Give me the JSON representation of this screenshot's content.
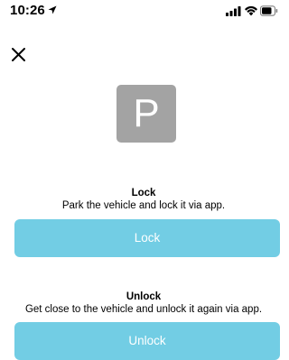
{
  "status_bar": {
    "time": "10:26",
    "icons": [
      "location-arrow-icon",
      "signal-bars-icon",
      "wifi-icon",
      "battery-icon"
    ]
  },
  "header": {
    "close_icon": "close-icon"
  },
  "parking": {
    "symbol": "P"
  },
  "lock": {
    "title": "Lock",
    "description": "Park the vehicle and lock it via app.",
    "button_label": "Lock"
  },
  "unlock": {
    "title": "Unlock",
    "description": "Get close to the vehicle and unlock it again via app.",
    "button_label": "Unlock"
  },
  "colors": {
    "accent": "#72cde4",
    "tile": "#a3a3a3"
  }
}
